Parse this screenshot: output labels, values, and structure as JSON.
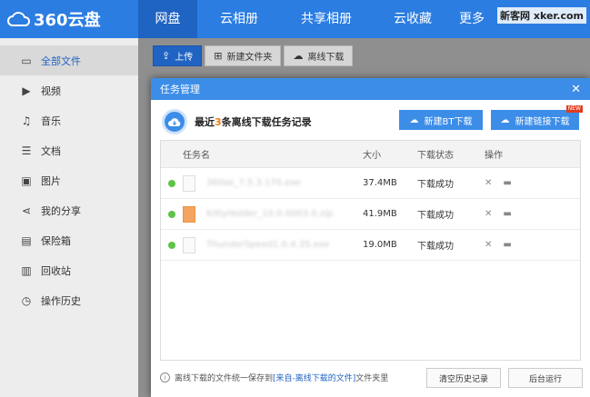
{
  "app": {
    "logo_text": "360云盘"
  },
  "nav": {
    "items": [
      "网盘",
      "云相册",
      "共享相册",
      "云收藏",
      "更多"
    ],
    "watermark": "新客网 xker.com"
  },
  "sidebar": {
    "items": [
      {
        "label": "全部文件",
        "icon": "folder-icon"
      },
      {
        "label": "视频",
        "icon": "video-icon"
      },
      {
        "label": "音乐",
        "icon": "music-icon"
      },
      {
        "label": "文档",
        "icon": "document-icon"
      },
      {
        "label": "图片",
        "icon": "image-icon"
      },
      {
        "label": "我的分享",
        "icon": "share-icon"
      },
      {
        "label": "保险箱",
        "icon": "safe-icon"
      },
      {
        "label": "回收站",
        "icon": "trash-icon"
      },
      {
        "label": "操作历史",
        "icon": "history-icon"
      }
    ]
  },
  "toolbar": {
    "upload": "上传",
    "new_share_folder": "新建文件夹",
    "offline_download": "离线下载"
  },
  "dialog": {
    "title": "任务管理",
    "heading_prefix": "最近",
    "heading_count": "3",
    "heading_suffix": "条离线下载任务记录",
    "btn_new_bt": "新建BT下载",
    "btn_new_link": "新建链接下载",
    "new_badge": "NEW",
    "columns": {
      "name": "任务名",
      "size": "大小",
      "status": "下载状态",
      "actions": "操作"
    },
    "rows": [
      {
        "name": "360se_7.5.3.170.exe",
        "size": "37.4MB",
        "status": "下载成功"
      },
      {
        "name": "KittyHolder_10.0.0003.0.zip",
        "size": "41.9MB",
        "status": "下载成功"
      },
      {
        "name": "ThunderSpeed1.0.4.35.exe",
        "size": "19.0MB",
        "status": "下载成功"
      }
    ],
    "footer_prefix": "离线下载的文件统一保存到",
    "footer_link": "[来自-离线下载的文件]",
    "footer_suffix": "文件夹里",
    "btn_clear": "清空历史记录",
    "btn_background": "后台运行"
  },
  "colors": {
    "brand": "#2b7de2",
    "accent": "#3c8de8",
    "success": "#5ec449",
    "highlight": "#f07b1a"
  }
}
